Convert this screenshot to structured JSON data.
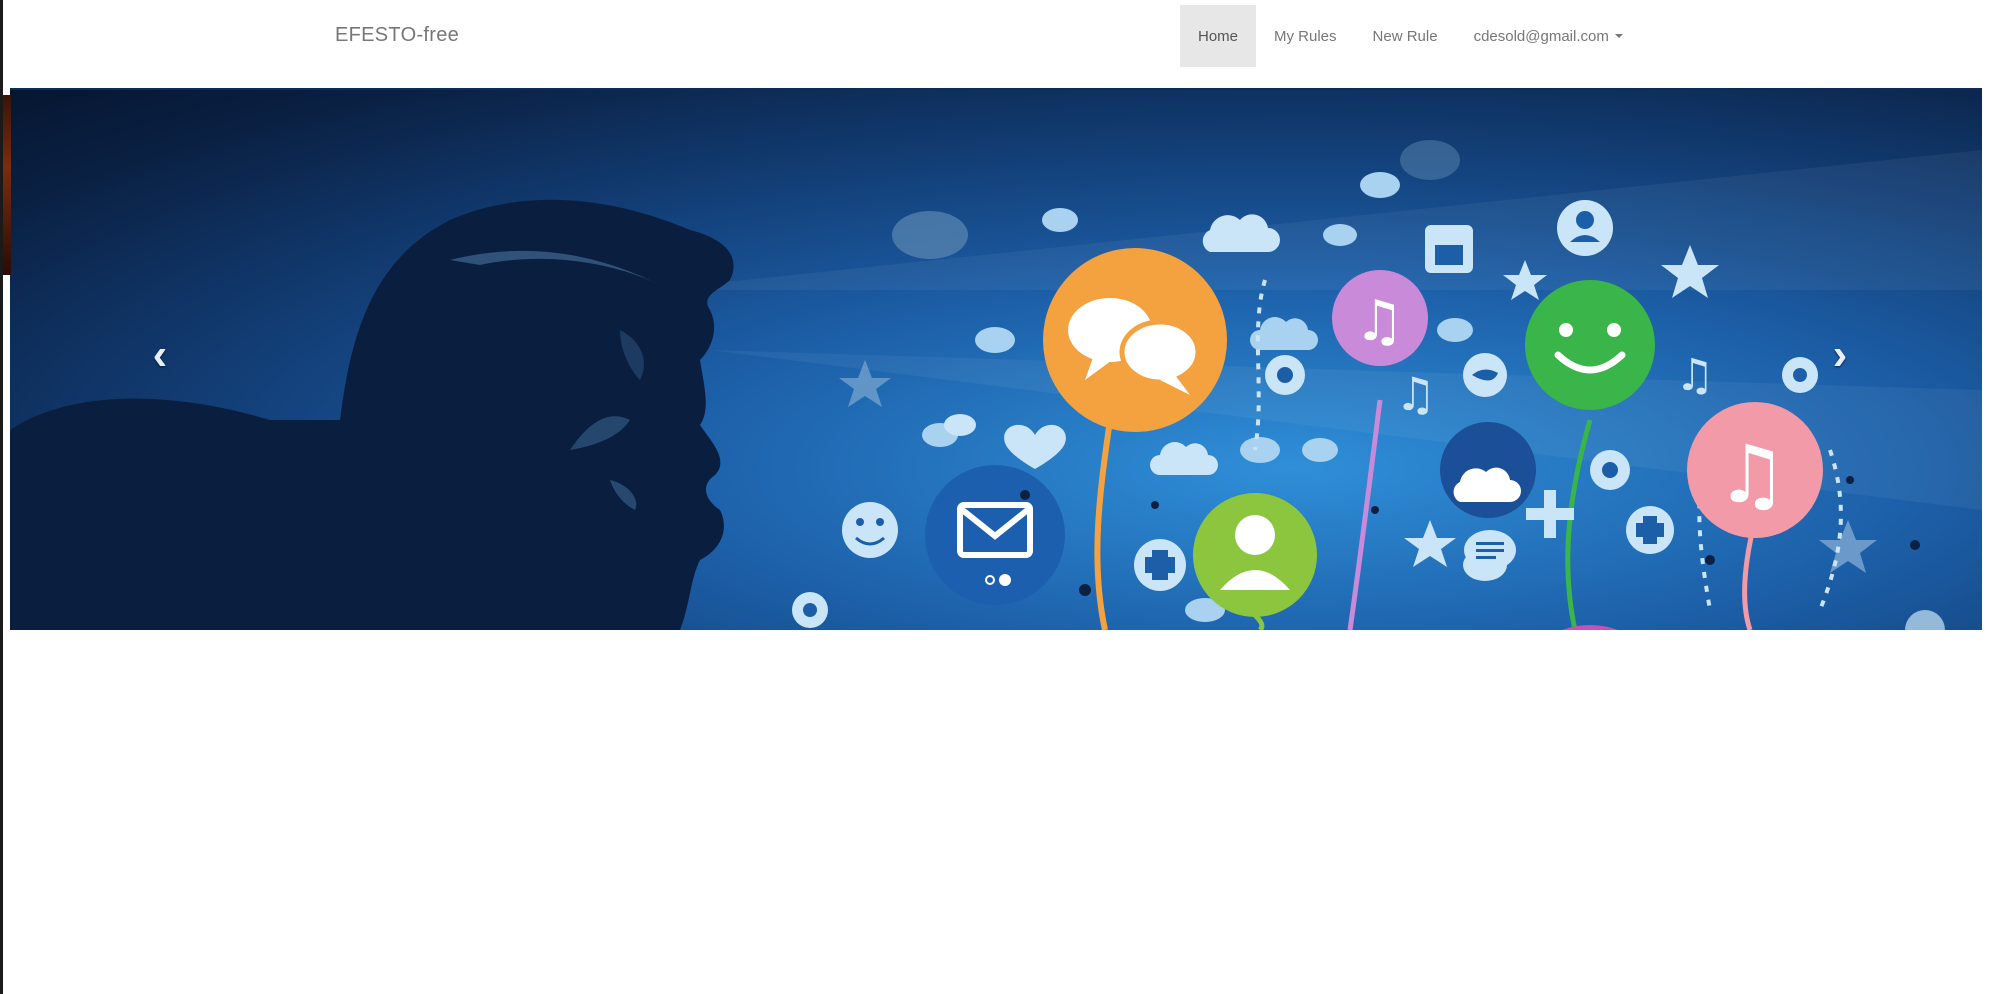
{
  "navbar": {
    "brand": "EFESTO-free",
    "items": [
      {
        "label": "Home",
        "active": true
      },
      {
        "label": "My Rules",
        "active": false
      },
      {
        "label": "New Rule",
        "active": false
      },
      {
        "label": "cdesold@gmail.com",
        "active": false,
        "dropdown": true
      }
    ]
  },
  "carousel": {
    "prev_icon": "chevron-left-icon",
    "next_icon": "chevron-right-icon",
    "prev_glyph": "‹",
    "next_glyph": "›"
  },
  "colors": {
    "navbar_bg": "#ffffff",
    "nav_active_bg": "#e7e7e7",
    "nav_text": "#777777",
    "hero_dark": "#061631",
    "hero_light": "#2f8fd8",
    "bubble_orange": "#f4a23f",
    "bubble_pink": "#c88ad9",
    "bubble_green": "#39b54a",
    "bubble_lime": "#8cc63f",
    "bubble_rose": "#f29aa8",
    "bubble_blue": "#1b5fae"
  }
}
